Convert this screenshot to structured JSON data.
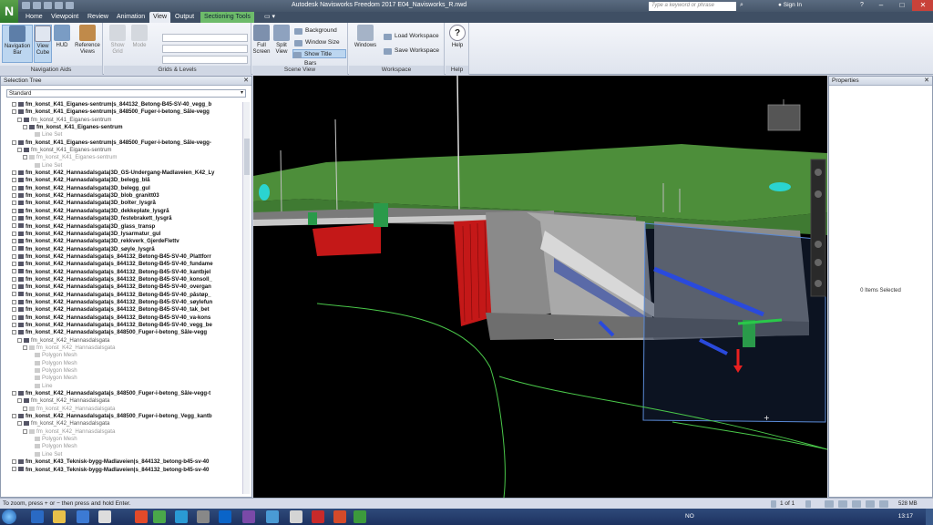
{
  "titlebar": {
    "logo": "N",
    "title": "Autodesk Navisworks Freedom 2017    E04_Navisworks_R.nwd",
    "search_placeholder": "Type a keyword or phrase",
    "sign_in": "Sign In",
    "help": "?",
    "minimize": "–",
    "maximize": "□",
    "close": "✕"
  },
  "tabs": [
    "Home",
    "Viewpoint",
    "Review",
    "Animation",
    "View",
    "Output",
    "Sectioning Tools"
  ],
  "tab_extra": "▭ ▾",
  "ribbon": {
    "navigation_aids": {
      "label": "Navigation Aids",
      "navigation_bar": "Navigation Bar",
      "view_cube": "View Cube",
      "hud": "HUD",
      "reference_views": "Reference Views"
    },
    "grids_levels": {
      "label": "Grids & Levels",
      "show_grid": "Show Grid",
      "mode": "Mode"
    },
    "scene_view": {
      "label": "Scene View",
      "full_screen": "Full Screen",
      "split_view": "Split View",
      "background": "Background",
      "window_size": "Window Size",
      "show_title_bars": "Show Title Bars"
    },
    "workspace": {
      "label": "Workspace",
      "windows": "Windows",
      "load_workspace": "Load Workspace",
      "save_workspace": "Save Workspace"
    },
    "help": {
      "label": "Help",
      "help": "Help"
    }
  },
  "selection_tree": {
    "title": "Selection Tree",
    "close": "✕",
    "mode": "Standard",
    "rows": [
      {
        "t": "fm_konst_K41_Eiganes-sentrum|s_844132_Betong-B45-SV-40_vegg_b",
        "s": "b",
        "i": 2
      },
      {
        "t": "fm_konst_K41_Eiganes-sentrum|s_848500_Fuger-i-betong_Såle-vegg",
        "s": "b",
        "i": 2
      },
      {
        "t": "fm_konst_K41_Eiganes-sentrum",
        "s": "m",
        "i": 4
      },
      {
        "t": "fm_konst_K41_Eiganes-sentrum",
        "s": "b",
        "i": 6
      },
      {
        "t": "Line Set",
        "s": "g",
        "i": 8
      },
      {
        "t": "fm_konst_K41_Eiganes-sentrum|s_848500_Fuger-i-betong_Såle-vegg-",
        "s": "b",
        "i": 2
      },
      {
        "t": "fm_konst_K41_Eiganes-sentrum",
        "s": "m",
        "i": 4
      },
      {
        "t": "fm_konst_K41_Eiganes-sentrum",
        "s": "g",
        "i": 6
      },
      {
        "t": "Line Set",
        "s": "g",
        "i": 8
      },
      {
        "t": "fm_konst_K42_Hannasdalsgata|3D_GS-Undergang-Madlaveien_K42_Ly",
        "s": "b",
        "i": 2
      },
      {
        "t": "fm_konst_K42_Hannasdalsgata|3D_belegg_blå",
        "s": "b",
        "i": 2
      },
      {
        "t": "fm_konst_K42_Hannasdalsgata|3D_belegg_gul",
        "s": "b",
        "i": 2
      },
      {
        "t": "fm_konst_K42_Hannasdalsgata|3D_blob_granitt03",
        "s": "b",
        "i": 2
      },
      {
        "t": "fm_konst_K42_Hannasdalsgata|3D_bolter_lysgrå",
        "s": "b",
        "i": 2
      },
      {
        "t": "fm_konst_K42_Hannasdalsgata|3D_dekkeplate_lysgrå",
        "s": "b",
        "i": 2
      },
      {
        "t": "fm_konst_K42_Hannasdalsgata|3D_festebrakett_lysgrå",
        "s": "b",
        "i": 2
      },
      {
        "t": "fm_konst_K42_Hannasdalsgata|3D_glass_transp",
        "s": "b",
        "i": 2
      },
      {
        "t": "fm_konst_K42_Hannasdalsgata|3D_lysarmatur_gul",
        "s": "b",
        "i": 2
      },
      {
        "t": "fm_konst_K42_Hannasdalsgata|3D_rekkverk_GjerdeFlettv",
        "s": "b",
        "i": 2
      },
      {
        "t": "fm_konst_K42_Hannasdalsgata|3D_søyle_lysgrå",
        "s": "b",
        "i": 2
      },
      {
        "t": "fm_konst_K42_Hannasdalsgata|s_844132_Betong-B45-SV-40_Plattforr",
        "s": "b",
        "i": 2
      },
      {
        "t": "fm_konst_K42_Hannasdalsgata|s_844132_Betong-B45-SV-40_fundame",
        "s": "b",
        "i": 2
      },
      {
        "t": "fm_konst_K42_Hannasdalsgata|s_844132_Betong-B45-SV-40_kantbjel",
        "s": "b",
        "i": 2
      },
      {
        "t": "fm_konst_K42_Hannasdalsgata|s_844132_Betong-B45-SV-40_konsoll_",
        "s": "b",
        "i": 2
      },
      {
        "t": "fm_konst_K42_Hannasdalsgata|s_844132_Betong-B45-SV-40_overgan",
        "s": "b",
        "i": 2
      },
      {
        "t": "fm_konst_K42_Hannasdalsgata|s_844132_Betong-B45-SV-40_påstøp_",
        "s": "b",
        "i": 2
      },
      {
        "t": "fm_konst_K42_Hannasdalsgata|s_844132_Betong-B45-SV-40_søylefun",
        "s": "b",
        "i": 2
      },
      {
        "t": "fm_konst_K42_Hannasdalsgata|s_844132_Betong-B45-SV-40_tak_bet",
        "s": "b",
        "i": 2
      },
      {
        "t": "fm_konst_K42_Hannasdalsgata|s_844132_Betong-B45-SV-40_va-kons",
        "s": "b",
        "i": 2
      },
      {
        "t": "fm_konst_K42_Hannasdalsgata|s_844132_Betong-B45-SV-40_vegg_be",
        "s": "b",
        "i": 2
      },
      {
        "t": "fm_konst_K42_Hannasdalsgata|s_848500_Fuger-i-betong_Såle-vegg",
        "s": "b",
        "i": 2
      },
      {
        "t": "fm_konst_K42_Hannasdalsgata",
        "s": "m",
        "i": 4
      },
      {
        "t": "fm_konst_K42_Hannasdalsgata",
        "s": "g",
        "i": 6
      },
      {
        "t": "Polygon Mesh",
        "s": "g",
        "i": 8
      },
      {
        "t": "Polygon Mesh",
        "s": "g",
        "i": 8
      },
      {
        "t": "Polygon Mesh",
        "s": "g",
        "i": 8
      },
      {
        "t": "Polygon Mesh",
        "s": "g",
        "i": 8
      },
      {
        "t": "Line",
        "s": "g",
        "i": 8
      },
      {
        "t": "fm_konst_K42_Hannasdalsgata|s_848500_Fuger-i-betong_Såle-vegg-t",
        "s": "b",
        "i": 2
      },
      {
        "t": "fm_konst_K42_Hannasdalsgata",
        "s": "m",
        "i": 4
      },
      {
        "t": "fm_konst_K42_Hannasdalsgata",
        "s": "g",
        "i": 6
      },
      {
        "t": "fm_konst_K42_Hannasdalsgata|s_848500_Fuger-i-betong_Vegg_kantb",
        "s": "b",
        "i": 2
      },
      {
        "t": "fm_konst_K42_Hannasdalsgata",
        "s": "m",
        "i": 4
      },
      {
        "t": "fm_konst_K42_Hannasdalsgata",
        "s": "g",
        "i": 6
      },
      {
        "t": "Polygon Mesh",
        "s": "g",
        "i": 8
      },
      {
        "t": "Polygon Mesh",
        "s": "g",
        "i": 8
      },
      {
        "t": "Line Set",
        "s": "g",
        "i": 8
      },
      {
        "t": "fm_konst_K43_Teknisk-bygg-Madlaveien|s_844132_betong-b45-sv-40",
        "s": "b",
        "i": 2
      },
      {
        "t": "fm_konst_K43_Teknisk-bygg-Madlaveien|s_844132_betong-b45-sv-40",
        "s": "b",
        "i": 2
      }
    ]
  },
  "properties": {
    "title": "Properties",
    "close": "✕",
    "empty": "0 Items Selected"
  },
  "statusbar": {
    "hint": "To zoom, press + or − then press and hold Enter.",
    "page": "1 of 1",
    "memory": "528 MB"
  },
  "taskbar": {
    "lang": "NO",
    "time": "13:17"
  },
  "colors": {
    "title_bg": "#46566a",
    "context_tab": "#6dbb6a",
    "viewport_bg": "#000000",
    "ground_green": "#4a8a3a",
    "red_structure": "#c41818",
    "blue_section": "#2a4adc"
  }
}
